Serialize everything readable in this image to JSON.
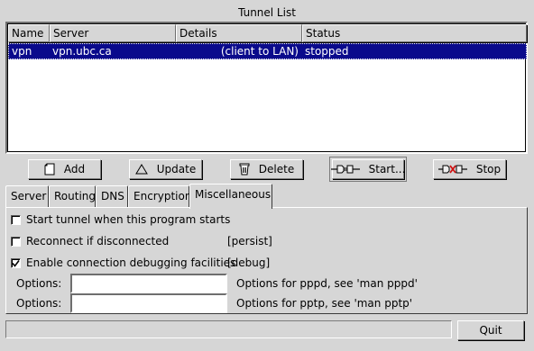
{
  "tunnel_list": {
    "title": "Tunnel List",
    "columns": [
      "Name",
      "Server",
      "Details",
      "Status"
    ],
    "rows": [
      {
        "name": "vpn",
        "server": "vpn.ubc.ca",
        "details": "(client to LAN)",
        "status": "stopped",
        "selected": true
      }
    ]
  },
  "actions": {
    "add": "Add",
    "update": "Update",
    "delete": "Delete",
    "start": "Start...",
    "stop": "Stop"
  },
  "tabs": [
    {
      "label": "Server"
    },
    {
      "label": "Routing"
    },
    {
      "label": "DNS"
    },
    {
      "label": "Encryption"
    },
    {
      "label": "Miscellaneous",
      "active": true
    }
  ],
  "misc": {
    "start_tunnel": {
      "label": "Start tunnel when this program starts",
      "checked": false
    },
    "reconnect": {
      "label": "Reconnect if disconnected",
      "checked": false,
      "hint": "[persist]"
    },
    "debugging": {
      "label": "Enable connection debugging facilities",
      "checked": true,
      "hint": "[debug]"
    },
    "pppd_options": {
      "label": "Options:",
      "value": "",
      "hint": "Options for pppd, see 'man pppd'"
    },
    "pptp_options": {
      "label": "Options:",
      "value": "",
      "hint": "Options for pptp, see 'man pptp'"
    }
  },
  "status_bar": {
    "text": ""
  },
  "quit_label": "Quit",
  "colors": {
    "window_bg": "#d6d6d6",
    "selection_bg": "#0a0a8c",
    "selection_fg": "#ffffff",
    "stop_icon_x": "#d01010"
  }
}
